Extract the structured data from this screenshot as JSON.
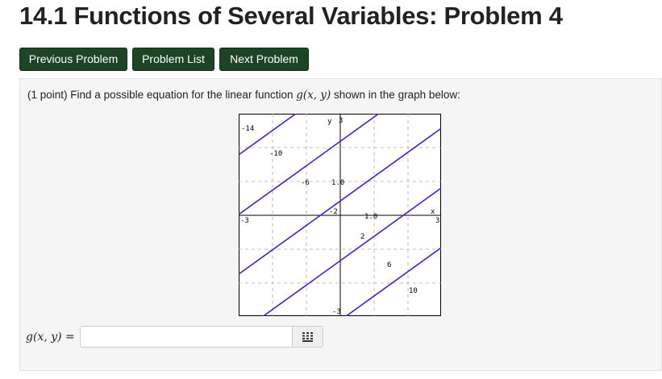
{
  "page": {
    "title": "14.1 Functions of Several Variables: Problem 4"
  },
  "nav": {
    "previous": "Previous Problem",
    "list": "Problem List",
    "next": "Next Problem"
  },
  "problem": {
    "points": "(1 point)",
    "text_before": "Find a possible equation for the linear function",
    "function": "g(x, y)",
    "text_after": "shown in the graph below:"
  },
  "graph": {
    "axis_labels": {
      "x": "x",
      "y": "y",
      "x_max": "3",
      "x_min": "-3",
      "y_max": "3",
      "y_min": "-3"
    },
    "contour_labels": [
      "-14",
      "-10",
      "-6",
      "-2",
      "2",
      "6",
      "10"
    ],
    "small_labels": [
      "1.0",
      "1.0"
    ],
    "line_color": "#3a22d6"
  },
  "answer": {
    "label": "g(x, y) =",
    "value": "",
    "placeholder": "",
    "equation_editor_icon": "keypad-icon"
  }
}
